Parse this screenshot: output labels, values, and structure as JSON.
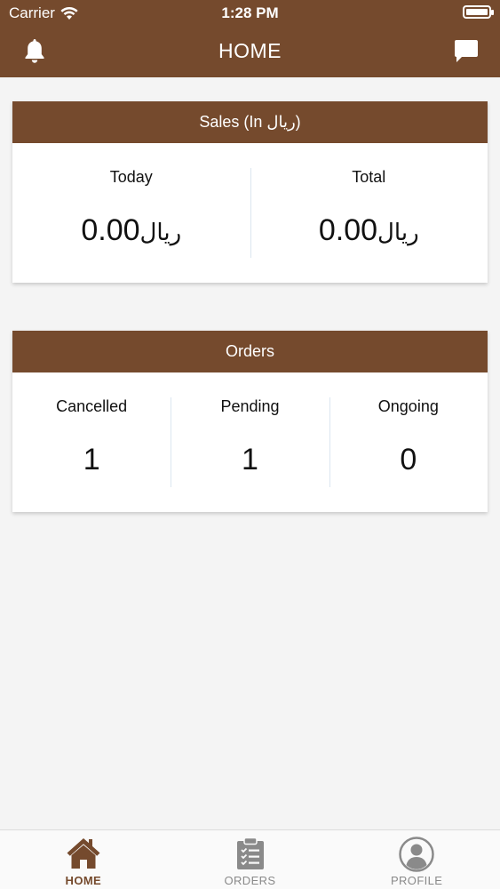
{
  "status_bar": {
    "carrier": "Carrier",
    "time": "1:28 PM"
  },
  "nav": {
    "title": "HOME"
  },
  "sales": {
    "title": "Sales (In ريال)",
    "columns": [
      {
        "label": "Today",
        "amount": "0.00",
        "currency": "ريال"
      },
      {
        "label": "Total",
        "amount": "0.00",
        "currency": "ريال"
      }
    ]
  },
  "orders": {
    "title": "Orders",
    "columns": [
      {
        "label": "Cancelled",
        "value": "1"
      },
      {
        "label": "Pending",
        "value": "1"
      },
      {
        "label": "Ongoing",
        "value": "0"
      }
    ]
  },
  "tabbar": {
    "items": [
      {
        "label": "HOME",
        "icon": "home-icon",
        "active": true
      },
      {
        "label": "ORDERS",
        "icon": "clipboard-list-icon",
        "active": false
      },
      {
        "label": "PROFILE",
        "icon": "user-circle-icon",
        "active": false
      }
    ]
  },
  "colors": {
    "brand": "#754a2d",
    "background": "#f4f4f4",
    "inactive_tab": "#8a8a8a"
  }
}
